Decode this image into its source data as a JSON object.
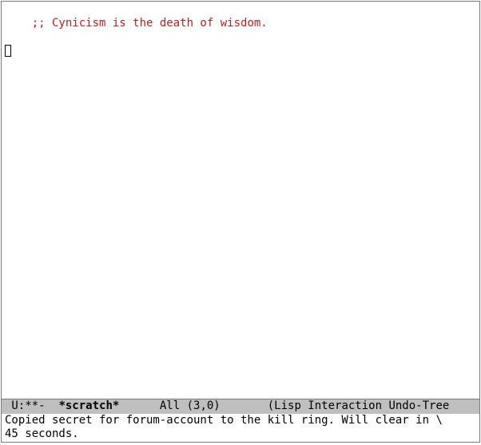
{
  "buffer": {
    "comment_line": ";; Cynicism is the death of wisdom."
  },
  "modeline": {
    "left": " U:**-  ",
    "buffer_name": "*scratch*",
    "position": "      All (3,0)",
    "modes": "       (Lisp Interaction Undo-Tree"
  },
  "echo_area": {
    "message": "Copied secret for forum-account to the kill ring. Will clear in \\\n45 seconds."
  }
}
